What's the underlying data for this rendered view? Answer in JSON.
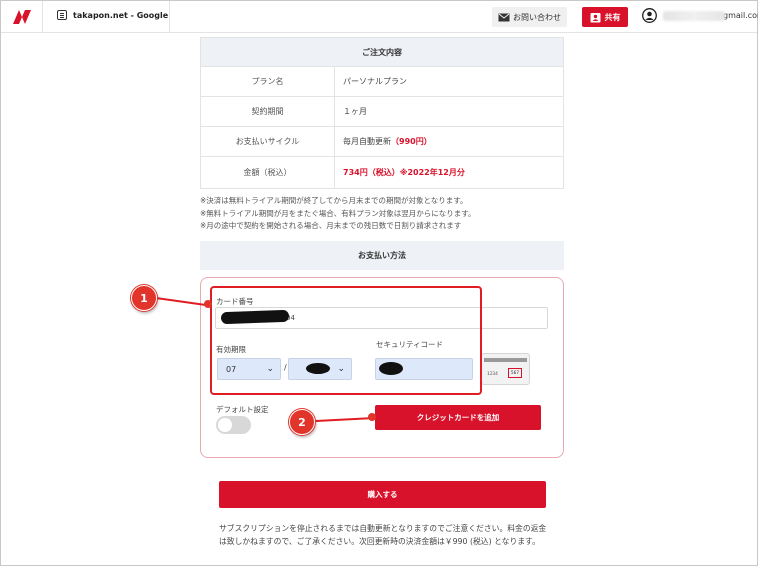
{
  "header": {
    "site_title": "takapon.net - Google",
    "contact_label": "お問い合わせ",
    "share_label": "共有",
    "account_suffix": "gmail.com"
  },
  "order": {
    "heading": "ご注文内容",
    "rows": [
      {
        "label": "プラン名",
        "value": "パーソナルプラン"
      },
      {
        "label": "契約期間",
        "value": "１ヶ月"
      },
      {
        "label": "お支払いサイクル",
        "value": "毎月自動更新",
        "value_red": "（990円）"
      },
      {
        "label": "金額（税込）",
        "value_red": "734円（税込）※2022年12月分"
      }
    ]
  },
  "notes": [
    "※決済は無料トライアル期間が終了してから月末までの期間が対象となります。",
    "※無料トライアル期間が月をまたぐ場合、有料プラン対象は翌月からになります。",
    "※月の途中で契約を開始される場合、月末までの残日数で日割り請求されます"
  ],
  "payment": {
    "heading": "お支払い方法",
    "card_number_label": "カード番号",
    "card_number_visible": "04",
    "expiry_label": "有効期限",
    "expiry_month": "07",
    "expiry_separator": "/",
    "security_code_label": "セキュリティコード",
    "card_sample_number": "1234",
    "card_sample_cvc": "567",
    "default_label": "デフォルト設定",
    "default_enabled": false,
    "add_card_label": "クレジットカードを追加"
  },
  "annotations": [
    "1",
    "2"
  ],
  "purchase_label": "購入する",
  "footer_note": "サブスクリプションを停止されるまでは自動更新となりますのでご注意ください。料金の返金は致しかねますので、ご了承ください。次回更新時の決済金額は￥990 (税込) となります。",
  "colors": {
    "accent": "#d9122b",
    "annotation": "#e1342b"
  },
  "icons": {
    "logo": "brand-logo-icon",
    "contact": "mail-icon",
    "share": "share-person-icon",
    "account": "account-circle-icon"
  }
}
